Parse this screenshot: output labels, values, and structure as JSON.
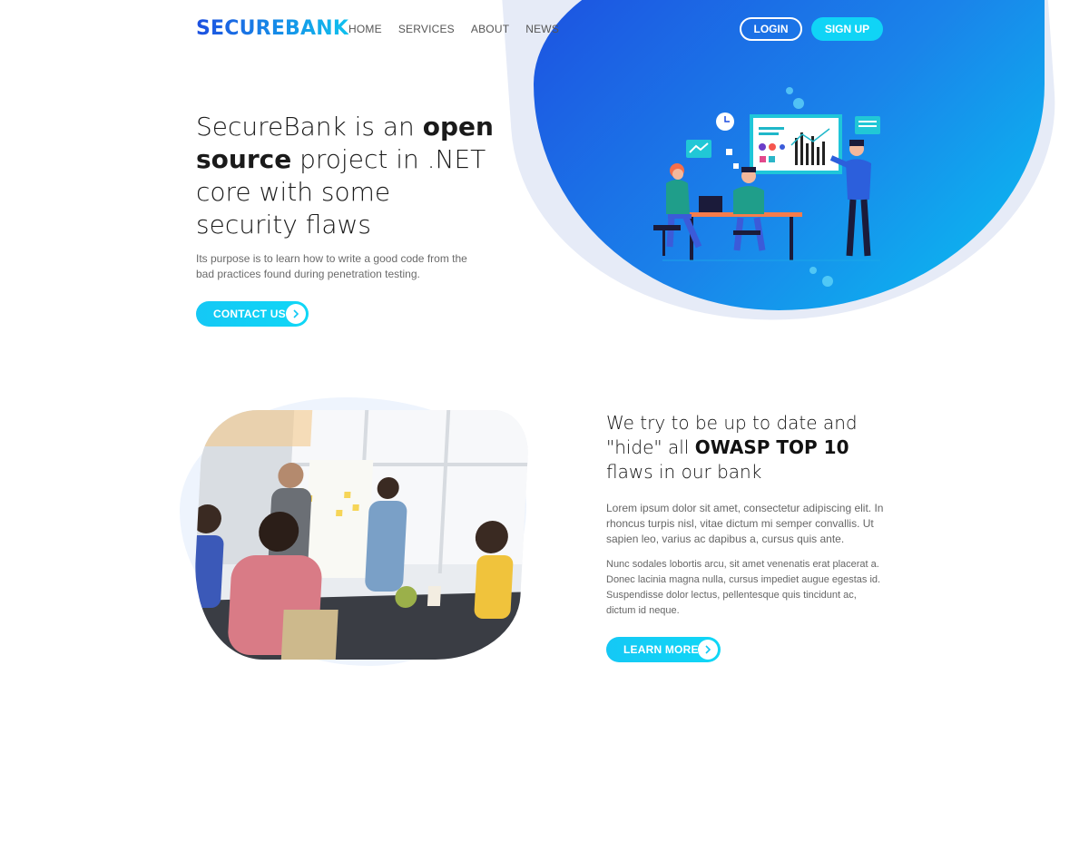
{
  "brand": {
    "logo": "SECUREBANK"
  },
  "nav": {
    "items": [
      "HOME",
      "SERVICES",
      "ABOUT",
      "NEWS"
    ]
  },
  "auth": {
    "login": "LOGIN",
    "signup": "SIGN UP"
  },
  "hero": {
    "title_parts": [
      "SecureBank is an ",
      "open source",
      " project in .NET core with some security flaws"
    ],
    "subtitle": "Its purpose is to learn how to write a good code from the bad practices found during penetration testing.",
    "cta": "CONTACT US"
  },
  "section": {
    "title_parts": [
      "We try to be up to date and \"hide\" all ",
      "OWASP TOP 10",
      " flaws in our bank"
    ],
    "paragraph1": "Lorem ipsum dolor sit amet, consectetur adipiscing elit. In rhoncus turpis nisl, vitae dictum mi semper convallis. Ut sapien leo, varius ac dapibus a, cursus quis ante.",
    "paragraph2": "Nunc sodales lobortis arcu, sit amet venenatis erat placerat a. Donec lacinia magna nulla, cursus impediet augue egestas id. Suspendisse dolor lectus, pellentesque quis tincidunt ac, dictum id neque.",
    "cta": "LEARN MORE"
  },
  "icons": {
    "chevron": "chevron-right-icon",
    "illustration": "team-meeting-illustration",
    "photo": "office-meeting-photo"
  },
  "colors": {
    "brand_start": "#1d4fe0",
    "brand_end": "#10c1ee",
    "accent": "#10d4f6"
  }
}
